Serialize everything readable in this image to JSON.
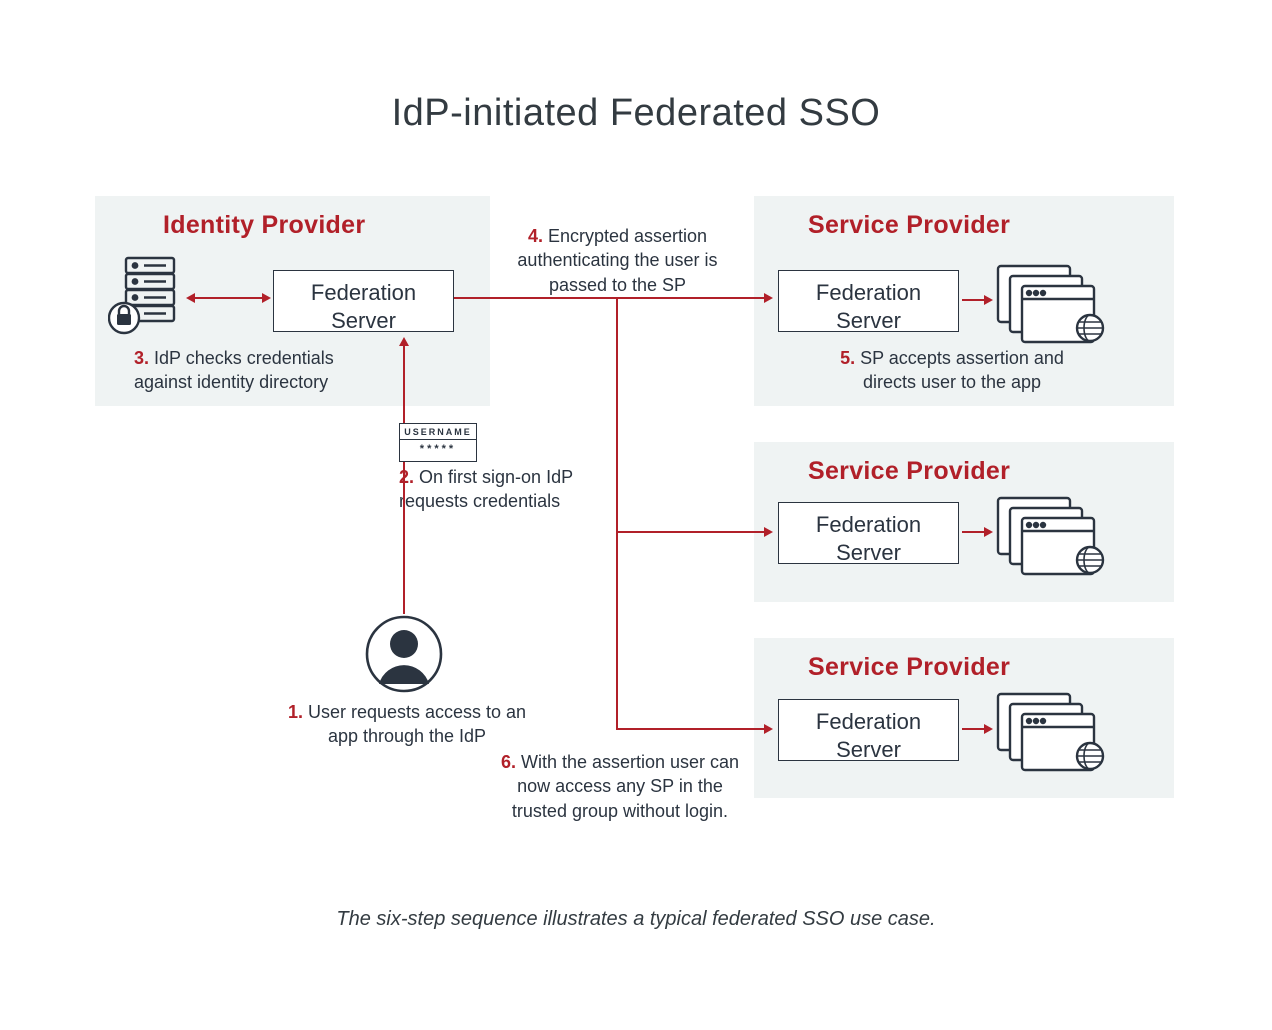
{
  "title": "IdP-initiated Federated SSO",
  "idp_title": "Identity Provider",
  "sp_title": "Service Provider",
  "federation_label": "Federation\nServer",
  "login": {
    "username_label": "USERNAME",
    "password_mask": "*****"
  },
  "steps": {
    "s1": {
      "num": "1.",
      "text": " User requests access to an app through the IdP"
    },
    "s2": {
      "num": "2.",
      "text": " On first sign-on IdP requests credentials"
    },
    "s3": {
      "num": "3.",
      "text": " IdP checks credentials against identity directory"
    },
    "s4": {
      "num": "4.",
      "text": " Encrypted assertion authenticating the user is passed to the SP"
    },
    "s5": {
      "num": "5.",
      "text": " SP accepts assertion and directs user to the app"
    },
    "s6": {
      "num": "6.",
      "text": " With the assertion user can now access any SP in the trusted group without login."
    }
  },
  "caption": "The six-step sequence illustrates a typical federated SSO use case."
}
